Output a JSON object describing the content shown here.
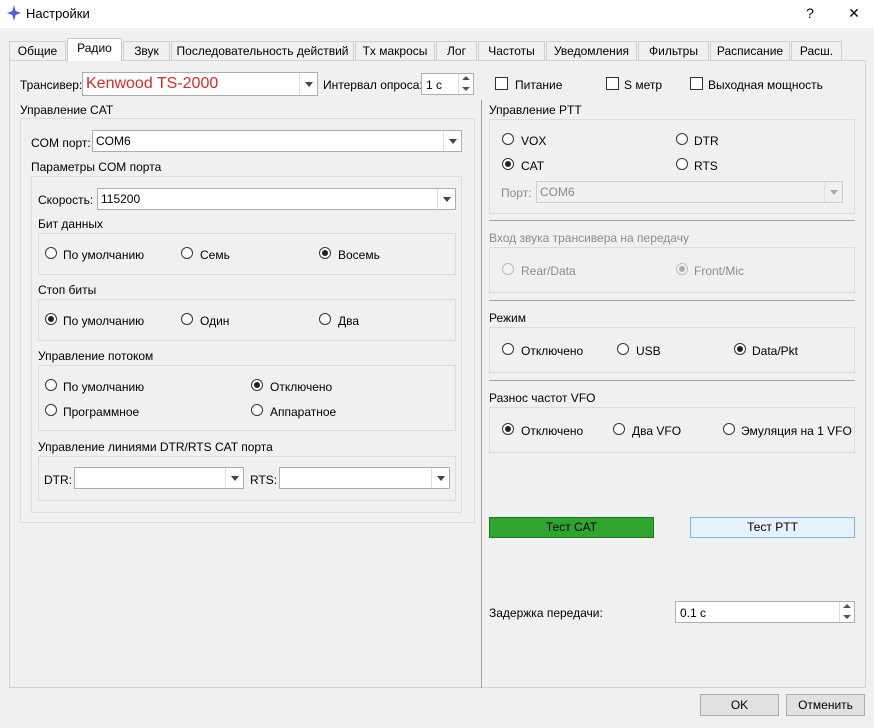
{
  "window": {
    "title": "Настройки",
    "help": "?",
    "close": "✕"
  },
  "tabs": [
    "Общие",
    "Радио",
    "Звук",
    "Последовательность действий",
    "Tx макросы",
    "Лог",
    "Частоты",
    "Уведомления",
    "Фильтры",
    "Расписание",
    "Расш."
  ],
  "active_tab": "Радио",
  "top": {
    "transceiver_label": "Трансивер:",
    "transceiver_value": "Kenwood TS-2000",
    "poll_label": "Интервал опроса:",
    "poll_value": "1 с",
    "power_label": "Питание",
    "smeter_label": "S метр",
    "outpower_label": "Выходная мощность"
  },
  "cat": {
    "title": "Управление CAT",
    "com_label": "COM порт:",
    "com_value": "COM6",
    "params_title": "Параметры COM порта",
    "speed_label": "Скорость:",
    "speed_value": "115200",
    "databits_title": "Бит данных",
    "databits": [
      "По умолчанию",
      "Семь",
      "Восемь"
    ],
    "stopbits_title": "Стоп биты",
    "stopbits": [
      "По умолчанию",
      "Один",
      "Два"
    ],
    "flow_title": "Управление потоком",
    "flow": [
      "По умолчанию",
      "Отключено",
      "Программное",
      "Аппаратное"
    ],
    "lines_title": "Управление линиями DTR/RTS CAT порта",
    "dtr_label": "DTR:",
    "rts_label": "RTS:"
  },
  "ptt": {
    "title": "Управление PTT",
    "options": [
      "VOX",
      "DTR",
      "CAT",
      "RTS"
    ],
    "port_label": "Порт:",
    "port_value": "COM6",
    "audio_title": "Вход звука трансивера на передачу",
    "audio": [
      "Rear/Data",
      "Front/Mic"
    ],
    "mode_title": "Режим",
    "mode": [
      "Отключено",
      "USB",
      "Data/Pkt"
    ],
    "vfo_title": "Разнос частот VFO",
    "vfo": [
      "Отключено",
      "Два VFO",
      "Эмуляция на 1 VFO"
    ],
    "test_cat": "Тест CAT",
    "test_ptt": "Тест PTT",
    "delay_label": "Задержка передачи:",
    "delay_value": "0.1 с"
  },
  "footer": {
    "ok": "OK",
    "cancel": "Отменить"
  },
  "colors": {
    "test_cat_bg": "#2fa52f",
    "transceiver_text": "#d42a2a"
  }
}
